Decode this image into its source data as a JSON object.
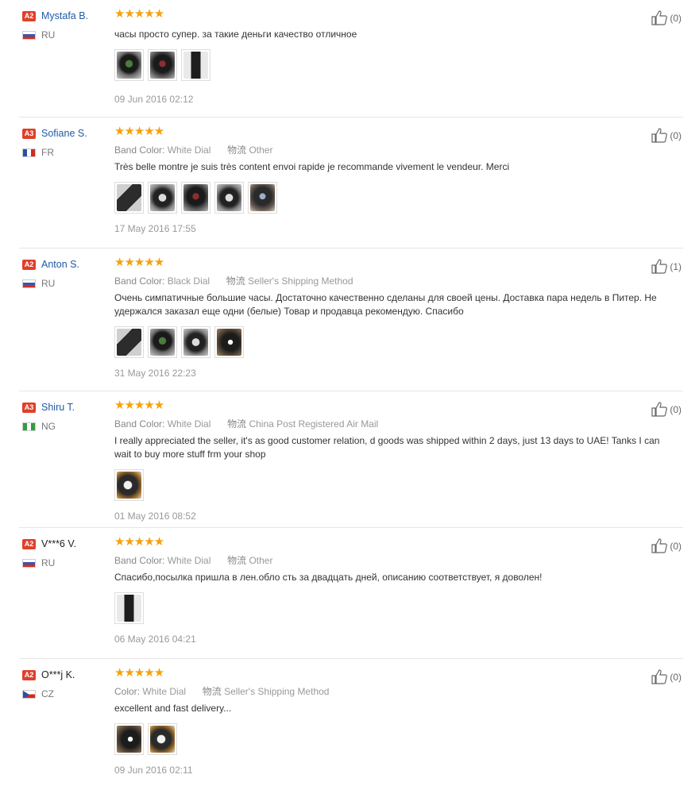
{
  "icons": {
    "useful": "thumbs-up-icon",
    "star": "star-icon",
    "flag": "flag-icon"
  },
  "colors": {
    "star": "#f5a20a",
    "level_badge": "#e0402a",
    "username_link": "#1f5aa6"
  },
  "reviews": [
    {
      "level": "A2",
      "name": "Mystafa B.",
      "country": "RU",
      "rating": 5,
      "stars": "★★★★★",
      "attrs": [],
      "text": "часы просто супер. за такие деньги качество отличное",
      "photo_count": 3,
      "date": "09 Jun 2016 02:12",
      "useful": "(0)"
    },
    {
      "level": "A3",
      "name": "Sofiane S.",
      "country": "FR",
      "rating": 5,
      "stars": "★★★★★",
      "attrs": [
        {
          "key": "Band Color:",
          "value": "White Dial"
        },
        {
          "key": "物流",
          "value": "Other"
        }
      ],
      "text": "Très belle montre je suis très content envoi rapide je recommande vivement le vendeur. Merci",
      "photo_count": 5,
      "date": "17 May 2016 17:55",
      "useful": "(0)"
    },
    {
      "level": "A2",
      "name": "Anton S.",
      "country": "RU",
      "rating": 5,
      "stars": "★★★★★",
      "attrs": [
        {
          "key": "Band Color:",
          "value": "Black Dial"
        },
        {
          "key": "物流",
          "value": "Seller's Shipping Method"
        }
      ],
      "text": "Очень симпатичные большие часы. Достаточно качественно сделаны для своей цены. Доставка пара недель в Питер. Не удержался заказал еще одни (белые) Товар и продавца рекомендую. Спасибо",
      "photo_count": 4,
      "date": "31 May 2016 22:23",
      "useful": "(1)"
    },
    {
      "level": "A3",
      "name": "Shiru T.",
      "country": "NG",
      "rating": 5,
      "stars": "★★★★★",
      "attrs": [
        {
          "key": "Band Color:",
          "value": "White Dial"
        },
        {
          "key": "物流",
          "value": "China Post Registered Air Mail"
        }
      ],
      "text": "I really appreciated the seller, it's as good customer relation, d goods was shipped within 2 days, just 13 days to UAE! Tanks I can wait to buy more stuff frm your shop",
      "photo_count": 1,
      "date": "01 May 2016 08:52",
      "useful": "(0)"
    },
    {
      "level": "A2",
      "name": "V***6 V.",
      "country": "RU",
      "rating": 5,
      "stars": "★★★★★",
      "attrs": [
        {
          "key": "Band Color:",
          "value": "White Dial"
        },
        {
          "key": "物流",
          "value": "Other"
        }
      ],
      "text": "Спасибо,посылка пришла в лен.обло сть за двадцать дней, описанию соответствует, я доволен!",
      "photo_count": 1,
      "date": "06 May 2016 04:21",
      "useful": "(0)"
    },
    {
      "level": "A2",
      "name": "O***j K.",
      "country": "CZ",
      "rating": 5,
      "stars": "★★★★★",
      "attrs": [
        {
          "key": "Color:",
          "value": "White Dial"
        },
        {
          "key": "物流",
          "value": "Seller's Shipping Method"
        }
      ],
      "text": "excellent and fast delivery...",
      "photo_count": 2,
      "date": "09 Jun 2016 02:11",
      "useful": "(0)"
    }
  ]
}
